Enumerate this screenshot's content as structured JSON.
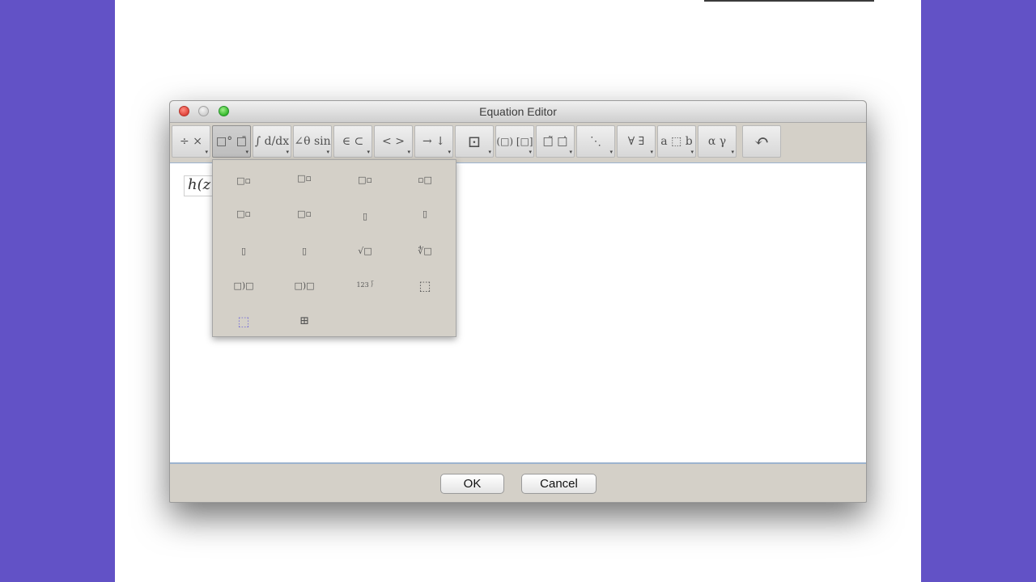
{
  "window": {
    "title": "Equation Editor"
  },
  "toolbar": {
    "buttons": [
      {
        "glyph": "÷ ×"
      },
      {
        "glyph": "□° □̄"
      },
      {
        "glyph": "∫ d/dx"
      },
      {
        "glyph": "∠θ sin"
      },
      {
        "glyph": "∈ ⊂"
      },
      {
        "glyph": "< >"
      },
      {
        "glyph": "→ ↓"
      },
      {
        "glyph": "⊡"
      },
      {
        "glyph": "(□) [□]"
      },
      {
        "glyph": "□̃ □̇"
      },
      {
        "glyph": "⋱"
      },
      {
        "glyph": "∀ ∃"
      },
      {
        "glyph": "a ⬚ b"
      },
      {
        "glyph": "α γ"
      },
      {
        "glyph": "↶"
      }
    ]
  },
  "editor": {
    "expression": "h(z"
  },
  "popup": {
    "items": [
      {
        "glyph": "□▫"
      },
      {
        "glyph": "□▫"
      },
      {
        "glyph": "□▫"
      },
      {
        "glyph": "▫□"
      },
      {
        "glyph": "□▫"
      },
      {
        "glyph": "□▫"
      },
      {
        "glyph": "▯"
      },
      {
        "glyph": "▯"
      },
      {
        "glyph": "▯"
      },
      {
        "glyph": "▯"
      },
      {
        "glyph": "√□"
      },
      {
        "glyph": "∜□"
      },
      {
        "glyph": "□)□"
      },
      {
        "glyph": "□)□"
      },
      {
        "glyph": "123 ⟌"
      },
      {
        "glyph": "⬚"
      },
      {
        "glyph": "⬚"
      },
      {
        "glyph": "⊞"
      }
    ]
  },
  "buttons": {
    "ok": "OK",
    "cancel": "Cancel"
  }
}
